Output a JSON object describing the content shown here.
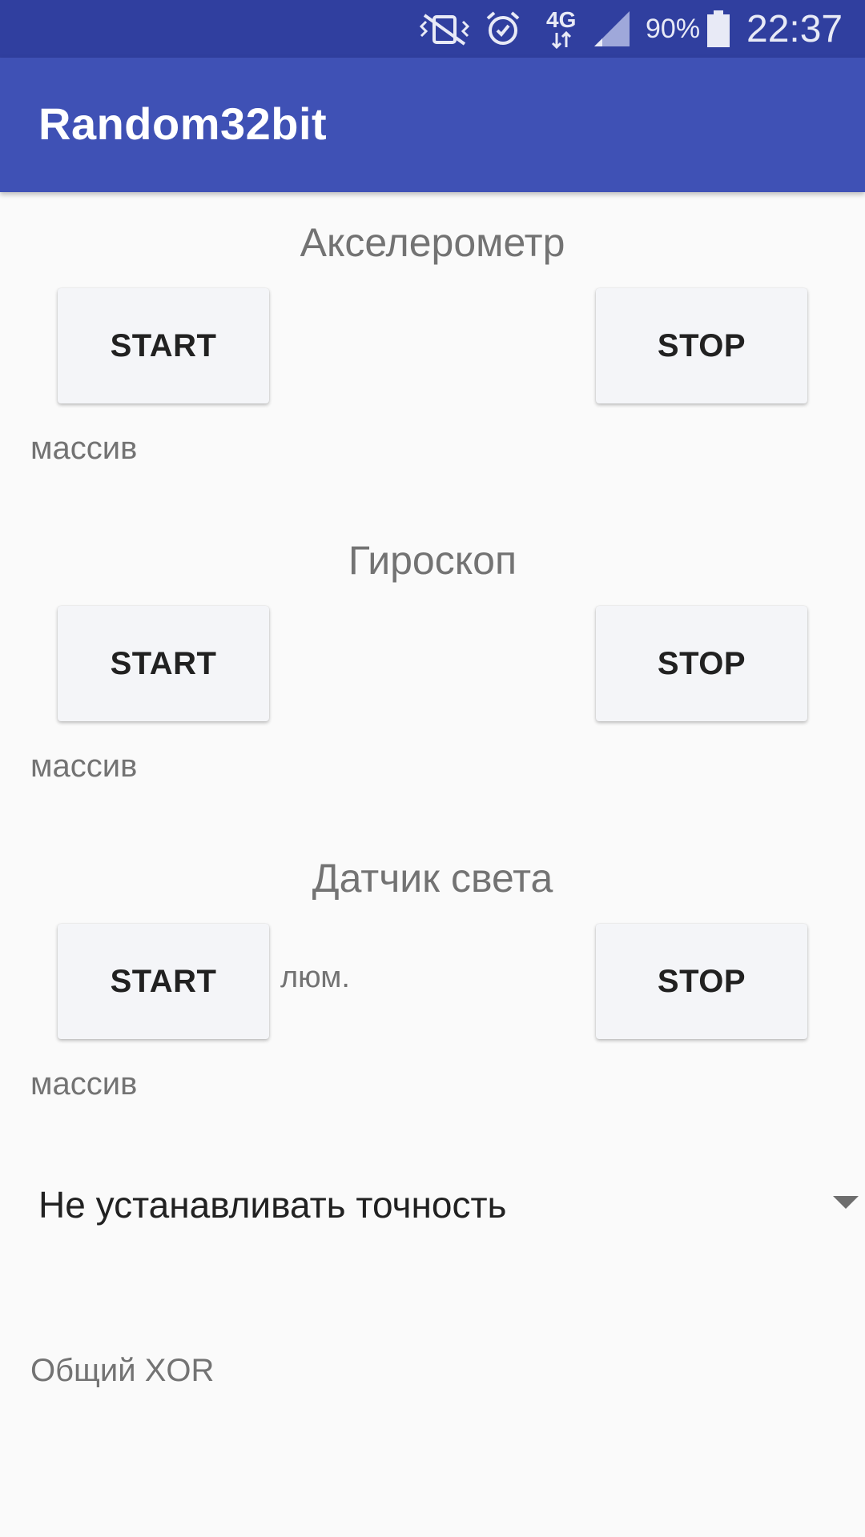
{
  "status_bar": {
    "icons": [
      "vibrate-mute-icon",
      "alarm-icon",
      "network-4g-icon",
      "signal-icon",
      "battery-icon"
    ],
    "network": "4G",
    "battery": "90%",
    "time": "22:37"
  },
  "app_bar": {
    "title": "Random32bit"
  },
  "sections": [
    {
      "title": "Акселерометр",
      "start": "START",
      "stop": "STOP",
      "array_label": "массив"
    },
    {
      "title": "Гироскоп",
      "start": "START",
      "stop": "STOP",
      "array_label": "массив"
    },
    {
      "title": "Датчик света",
      "start": "START",
      "stop": "STOP",
      "array_label": "массив",
      "unit": "люм."
    }
  ],
  "spinner": {
    "selected": "Не устанавливать точность",
    "icon": "dropdown-arrow-icon"
  },
  "xor_label": "Общий XOR",
  "colors": {
    "status_bar": "#303f9f",
    "app_bar": "#3f51b5",
    "background": "#fafafa"
  }
}
